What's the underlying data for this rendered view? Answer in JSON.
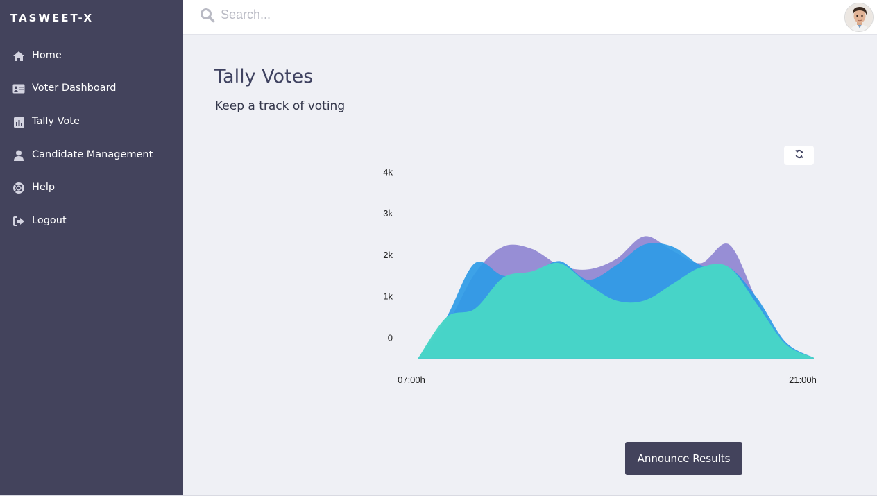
{
  "app": {
    "brand": "TASWEET-X"
  },
  "sidebar": {
    "items": [
      {
        "label": "Home",
        "icon": "home-icon"
      },
      {
        "label": "Voter Dashboard",
        "icon": "id-card-icon"
      },
      {
        "label": "Tally Vote",
        "icon": "bar-chart-icon"
      },
      {
        "label": "Candidate Management",
        "icon": "user-icon"
      },
      {
        "label": "Help",
        "icon": "life-ring-icon"
      },
      {
        "label": "Logout",
        "icon": "sign-out-icon"
      }
    ]
  },
  "search": {
    "placeholder": "Search..."
  },
  "main": {
    "title": "Tally Votes",
    "subtitle": "Keep a track of voting",
    "announce_label": "Announce Results"
  },
  "colors": {
    "sidebar": "#43435c",
    "purple": "#8f86d1",
    "blue": "#2e9be6",
    "teal": "#48d6c6"
  },
  "chart_data": {
    "type": "area",
    "x_tick_labels": [
      "07:00h",
      "21:00h"
    ],
    "y_tick_labels": [
      "0",
      "1k",
      "2k",
      "3k",
      "4k"
    ],
    "xlim": [
      0,
      14
    ],
    "ylim": [
      -500,
      4000
    ],
    "x": [
      0,
      1,
      2,
      3,
      4,
      5,
      6,
      7,
      8,
      9,
      10,
      11,
      12,
      13,
      14
    ],
    "series": [
      {
        "color": "#8f86d1",
        "values": [
          -480,
          300,
          1550,
          2200,
          2150,
          1750,
          1650,
          1900,
          2450,
          2100,
          1800,
          2250,
          900,
          -150,
          -480
        ]
      },
      {
        "color": "#2e9be6",
        "values": [
          -480,
          500,
          1800,
          1500,
          1550,
          1850,
          1400,
          1750,
          2250,
          2200,
          1750,
          1700,
          950,
          -100,
          -480
        ]
      },
      {
        "color": "#48d6c6",
        "values": [
          -480,
          500,
          700,
          1450,
          1600,
          1800,
          1300,
          900,
          900,
          1300,
          1700,
          1700,
          800,
          -150,
          -480
        ]
      }
    ]
  }
}
